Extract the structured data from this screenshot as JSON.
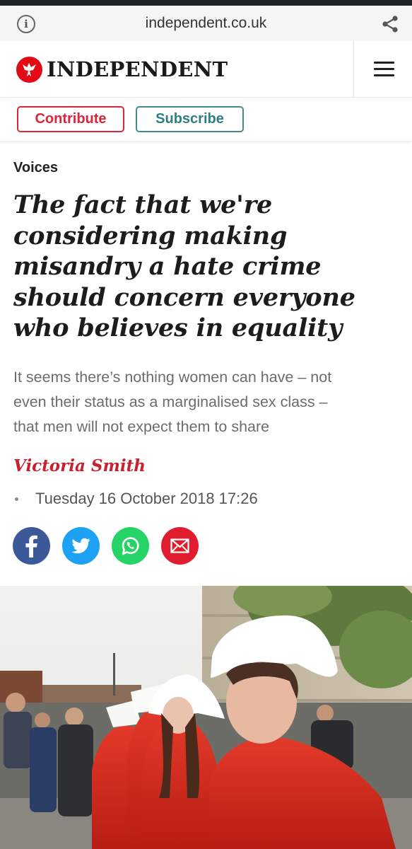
{
  "browser": {
    "url": "independent.co.uk",
    "info_icon": "info-icon",
    "share_icon": "share-icon"
  },
  "masthead": {
    "logo_text": "INDEPENDENT",
    "logo_icon": "eagle-logo-icon",
    "menu_icon": "hamburger-menu-icon"
  },
  "cta": {
    "contribute_label": "Contribute",
    "subscribe_label": "Subscribe"
  },
  "article": {
    "section": "Voices",
    "headline_lines": [
      "The fact that we're",
      "considering making",
      "misandry a hate crime",
      "should concern everyone",
      "who believes in equality"
    ],
    "standfirst_lines": [
      "It seems there’s nothing women can have – not",
      "even their status as a marginalised sex class –",
      "that men will not expect them to share"
    ],
    "author": "Victoria Smith",
    "date": "Tuesday 16 October 2018 17:26"
  },
  "share": {
    "icons": [
      "facebook-icon",
      "twitter-icon",
      "whatsapp-icon",
      "email-icon"
    ]
  },
  "colors": {
    "brand_red": "#e20a17",
    "author_red": "#c8202f",
    "contribute_red": "#d7273b",
    "subscribe_teal": "#2f7f80",
    "facebook": "#3b5998",
    "twitter": "#1da1f2",
    "whatsapp": "#25d366",
    "email": "#e01d2e"
  }
}
